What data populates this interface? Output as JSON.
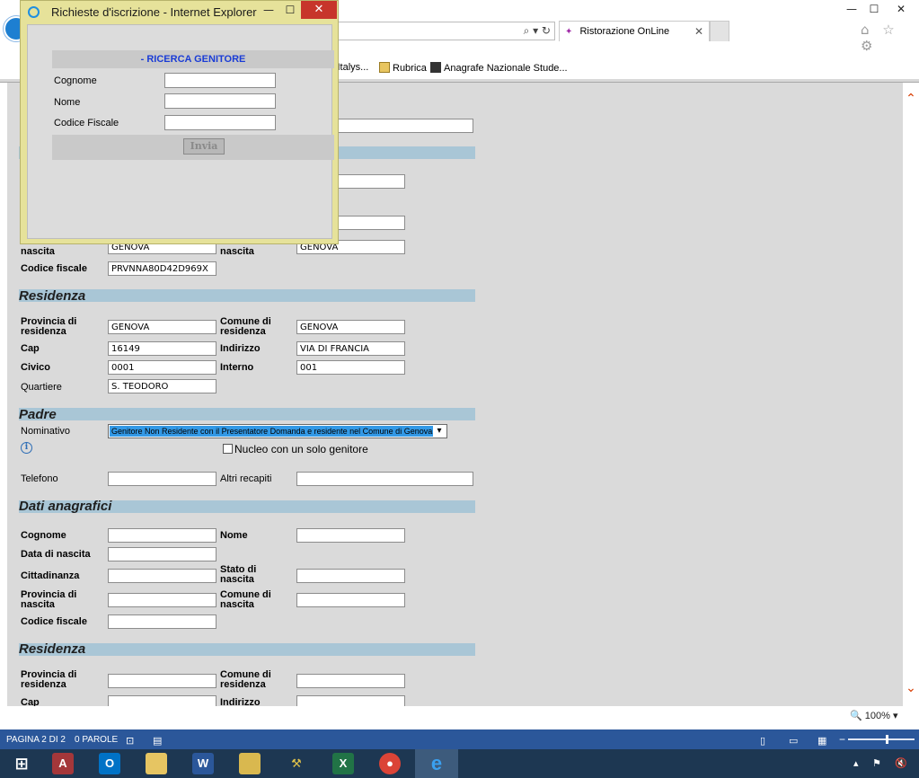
{
  "browser": {
    "tab_title": "Ristorazione OnLine",
    "tab_close": "✕",
    "address_icons": "⌕ ▾ ↻",
    "toolbar_icons": "⌂ ☆ ⚙",
    "window_controls": {
      "minimize": "—",
      "maximize": "☐",
      "close": "✕"
    },
    "favorites": [
      {
        "label": "i Italys...",
        "icon": "page-icon"
      },
      {
        "label": "Rubrica",
        "icon": "rubrica-icon"
      },
      {
        "label": "Anagrafe Nazionale Stude...",
        "icon": "anagrafe-icon"
      }
    ]
  },
  "popup": {
    "title": "Richieste d'iscrizione - Internet Explorer",
    "controls": {
      "minimize": "—",
      "maximize": "☐",
      "close": "✕"
    },
    "header": "- RICERCA GENITORE",
    "fields": [
      {
        "label": "Cognome",
        "value": ""
      },
      {
        "label": "Nome",
        "value": ""
      },
      {
        "label": "Codice Fiscale",
        "value": ""
      }
    ],
    "submit_label": "Invia"
  },
  "form": {
    "partial_top": {
      "nascita_left_label": "nascita",
      "nascita_left_value": "GENOVA",
      "nascita_right_label": "nascita",
      "nascita_right_value": "GENOVA",
      "codice_fiscale_label": "Codice fiscale",
      "codice_fiscale_value": "PRVNNA80D42D969X"
    },
    "residenza1": {
      "title": "Residenza",
      "provincia_label": "Provincia di residenza",
      "provincia_value": "GENOVA",
      "comune_label": "Comune di residenza",
      "comune_value": "GENOVA",
      "cap_label": "Cap",
      "cap_value": "16149",
      "indirizzo_label": "Indirizzo",
      "indirizzo_value": "VIA DI FRANCIA",
      "civico_label": "Civico",
      "civico_value": "0001",
      "interno_label": "Interno",
      "interno_value": "001",
      "quartiere_label": "Quartiere",
      "quartiere_value": "S. TEODORO"
    },
    "padre": {
      "title": "Padre",
      "nominativo_label": "Nominativo",
      "nominativo_value": "Genitore Non Residente con il Presentatore Domanda e residente nel Comune di Genova",
      "info_icon": "i",
      "nucleo_label": "Nucleo con un solo genitore",
      "nucleo_checked": false,
      "telefono_label": "Telefono",
      "telefono_value": "",
      "altri_label": "Altri recapiti",
      "altri_value": ""
    },
    "dati_anagrafici": {
      "title": "Dati anagrafici",
      "cognome_label": "Cognome",
      "nome_label": "Nome",
      "data_nascita_label": "Data di nascita",
      "cittadinanza_label": "Cittadinanza",
      "stato_nascita_label": "Stato di nascita",
      "provincia_nascita_label": "Provincia di nascita",
      "comune_nascita_label": "Comune di nascita",
      "codice_fiscale_label": "Codice fiscale"
    },
    "residenza2": {
      "title": "Residenza",
      "provincia_label": "Provincia di residenza",
      "comune_label": "Comune di residenza",
      "cap_label": "Cap",
      "indirizzo_label": "Indirizzo"
    }
  },
  "status_bar": {
    "page": "PAGINA 2 DI 2",
    "words": "0 PAROLE",
    "zoom": "100%"
  },
  "taskbar": {
    "apps": [
      "start-icon",
      "access-icon",
      "outlook-icon",
      "explorer-folder-icon",
      "word-icon",
      "files-icon",
      "tools-icon",
      "excel-icon",
      "chrome-icon",
      "internet-explorer-icon"
    ],
    "active_app": "internet-explorer-icon"
  },
  "colors": {
    "section_bar": "#a9c6d6",
    "popup_frame": "#e6e29a",
    "search_header_text": "#1a3cd6",
    "status_bar": "#2b579a",
    "taskbar": "#1d3752",
    "select_highlight": "#3399e6"
  }
}
